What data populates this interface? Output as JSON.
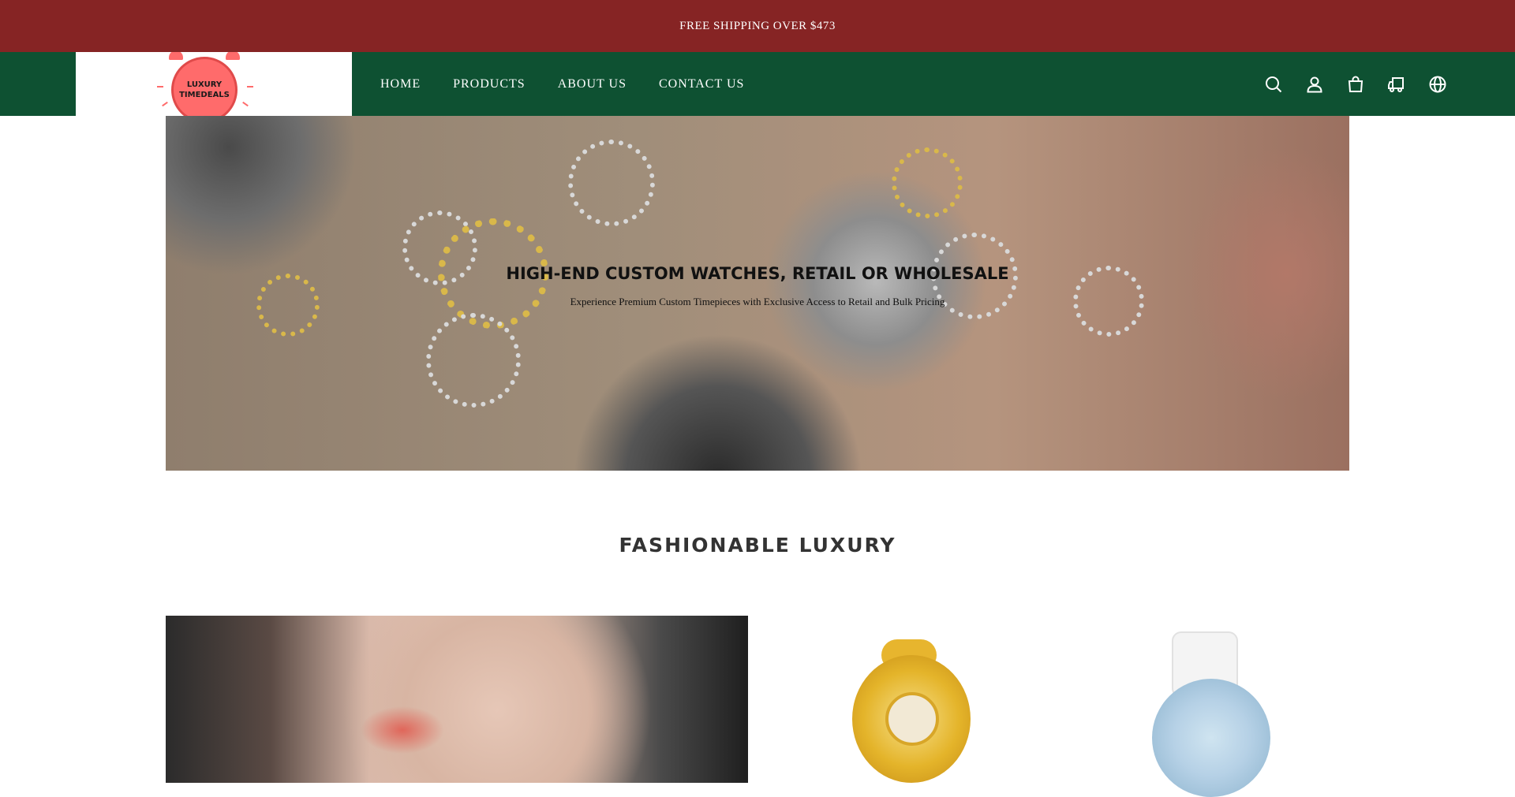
{
  "announcement": {
    "text": "FREE SHIPPING OVER $473"
  },
  "header": {
    "logo_line1": "LUXURY",
    "logo_line2": "TIMEDEALS",
    "nav": [
      {
        "label": "HOME"
      },
      {
        "label": "PRODUCTS"
      },
      {
        "label": "ABOUT US"
      },
      {
        "label": "CONTACT US"
      }
    ],
    "icons": [
      "search-icon",
      "account-icon",
      "cart-icon",
      "shipping-truck-icon",
      "globe-icon"
    ]
  },
  "hero": {
    "title": "HIGH-END CUSTOM WATCHES, RETAIL OR WHOLESALE",
    "subtitle": "Experience Premium Custom Timepieces with Exclusive Access to Retail and Bulk Pricing"
  },
  "section": {
    "title": "FASHIONABLE LUXURY"
  },
  "colors": {
    "announcement_bg": "#862424",
    "header_bg": "#0e5132",
    "logo_accent": "#ff6b6b"
  }
}
